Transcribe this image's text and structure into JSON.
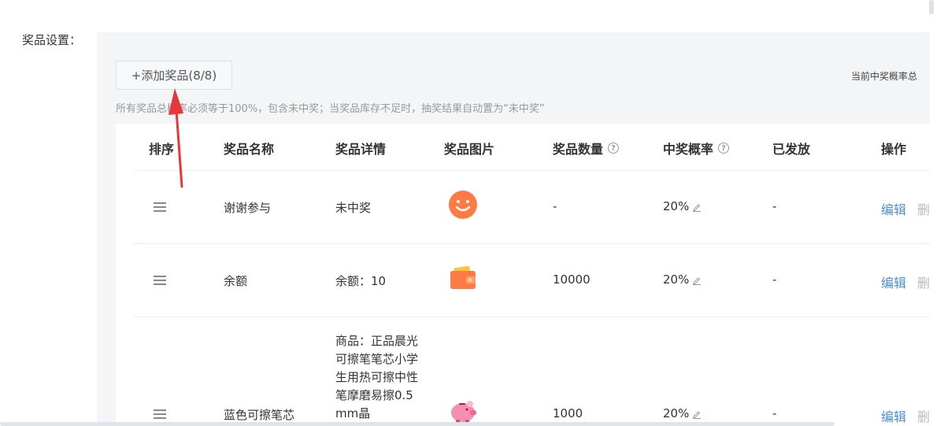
{
  "form": {
    "label": "奖品设置："
  },
  "toolbar": {
    "add_label": "+添加奖品(8/8)",
    "rate_summary": "当前中奖概率总"
  },
  "hint": "所有奖品总概率必须等于100%，包含未中奖；当奖品库存不足时，抽奖结果自动置为“未中奖”",
  "table": {
    "headers": {
      "sort": "排序",
      "name": "奖品名称",
      "detail": "奖品详情",
      "image": "奖品图片",
      "qty": "奖品数量",
      "prob": "中奖概率",
      "issued": "已发放",
      "ops": "操作"
    },
    "rows": [
      {
        "name": "谢谢参与",
        "detail": "未中奖",
        "image_icon": "smiley-icon",
        "qty": "-",
        "prob": "20%",
        "issued": "-",
        "edit": "编辑",
        "del": "删除"
      },
      {
        "name": "余额",
        "detail": "余额：10",
        "image_icon": "wallet-icon",
        "qty": "10000",
        "prob": "20%",
        "issued": "-",
        "edit": "编辑",
        "del": "删除"
      },
      {
        "name": "蓝色可擦笔芯",
        "detail": "商品：正品晨光可擦笔笔芯小学生用热可擦中性笔摩磨易擦0.5mm晶",
        "image_icon": "piggy-bank-icon",
        "qty": "1000",
        "prob": "20%",
        "issued": "-",
        "edit": "编辑",
        "del": "删除"
      }
    ]
  },
  "colors": {
    "accent": "#4a90d9",
    "icon_orange": "#ff7a45",
    "piggy_pink": "#f48fb1",
    "annotation_red": "#e8363b"
  }
}
